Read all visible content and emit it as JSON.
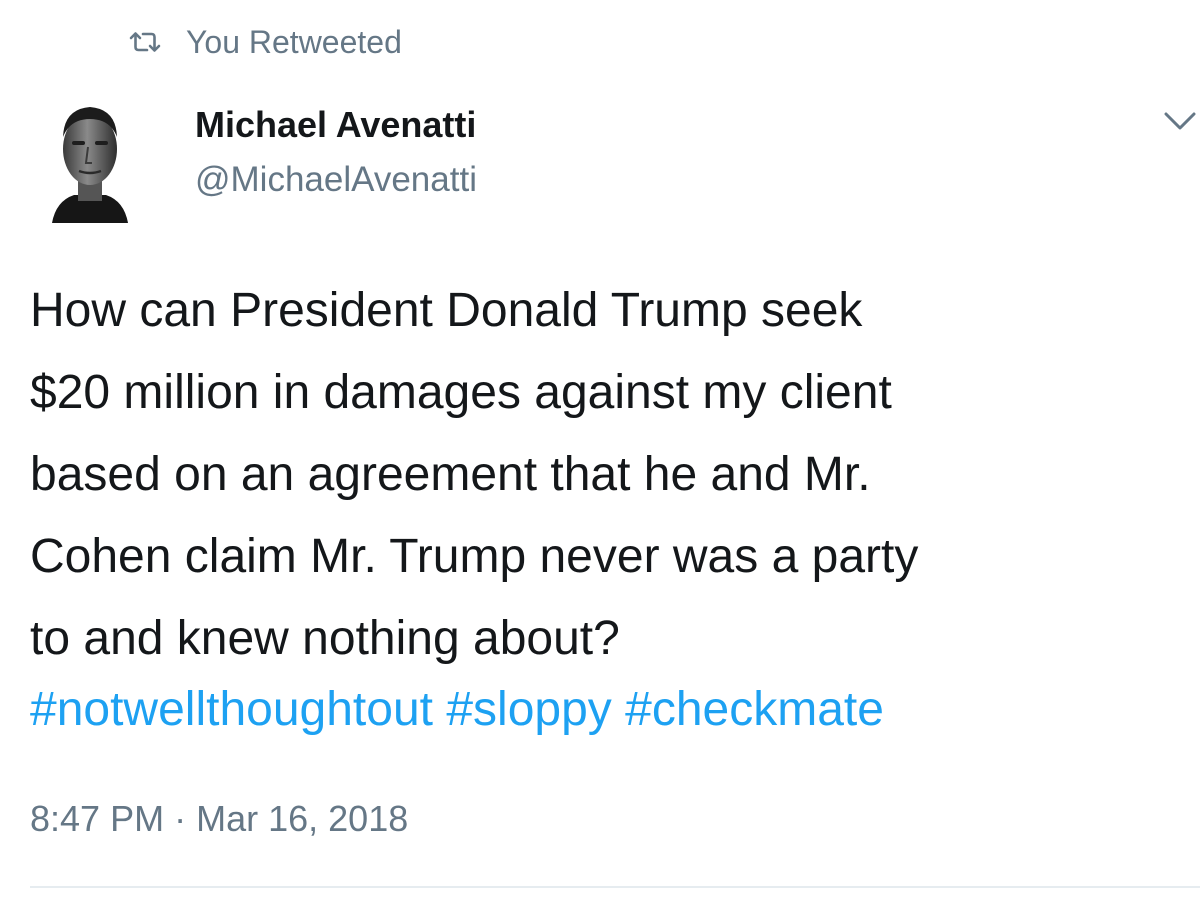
{
  "social_context": {
    "icon": "retweet-icon",
    "label": "You Retweeted"
  },
  "author": {
    "avatar": "avatar",
    "name": "Michael Avenatti",
    "handle": "@MichaelAvenatti"
  },
  "menu": {
    "icon": "chevron-down-icon"
  },
  "tweet": {
    "text": "How can President Donald Trump seek\n$20 million in damages against my client\nbased on an agreement that he and Mr.\nCohen claim Mr. Trump never was a party\nto and knew nothing about?",
    "hashtags": [
      "#notwellthoughtout",
      "#sloppy",
      "#checkmate"
    ],
    "time": "8:47 PM",
    "separator": "·",
    "date": "Mar 16, 2018"
  },
  "colors": {
    "link": "#1da1f2",
    "secondary_text": "#657786",
    "primary_text": "#14171a",
    "divider": "#e6ecf0"
  }
}
